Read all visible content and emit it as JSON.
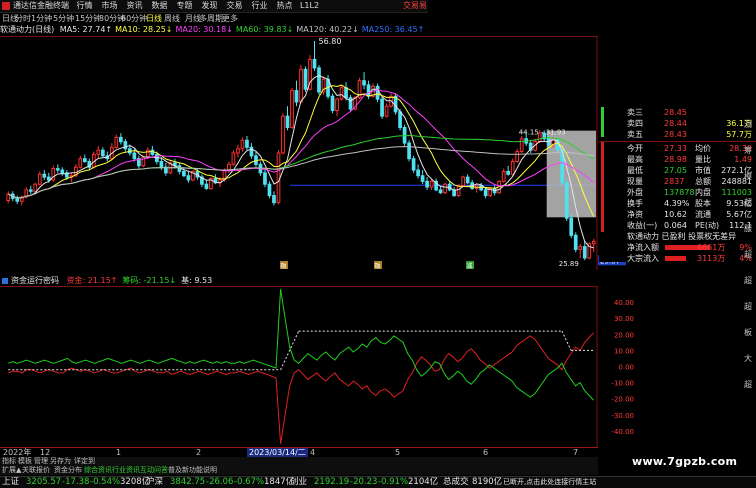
{
  "window": {
    "app_title": "通达信金融终端",
    "menu": [
      "行情",
      "市场",
      "资讯",
      "数据",
      "专题",
      "发现",
      "交易",
      "行业",
      "热点",
      "L1L2"
    ],
    "trade_button": "交易易"
  },
  "periods": {
    "items": [
      "日线",
      "分时",
      "1分钟",
      "5分钟",
      "15分钟",
      "30分钟",
      "60分钟",
      "日线",
      "周线",
      "月线",
      "多周期",
      "更多"
    ],
    "active_index": 7
  },
  "ma_legend": {
    "stock": "软通动力(日线)",
    "items": [
      {
        "label": "MA5: 27.74↑",
        "color": "#e6e6e6"
      },
      {
        "label": "MA10: 28.25↓",
        "color": "#ffff40"
      },
      {
        "label": "MA20: 30.18↓",
        "color": "#ff40ff"
      },
      {
        "label": "MA60: 39.83↓",
        "color": "#30d030"
      },
      {
        "label": "MA120: 40.22↓",
        "color": "#c0c0c0"
      },
      {
        "label": "MA250: 36.45↑",
        "color": "#3070ff"
      }
    ]
  },
  "price_axis": {
    "labels": [
      "46.00",
      "44.00",
      "42.00",
      "40.00",
      "38.00",
      "36.00",
      "34.00",
      "32.00",
      "30.00",
      "28.00",
      "26.00"
    ],
    "last_price_tag": "25.87"
  },
  "annotations": {
    "high_label": "56.80",
    "range_label": "44.15 - 31.93",
    "low_label": "25.89",
    "event_markers": [
      "融",
      "融",
      "减"
    ]
  },
  "order_book": {
    "rows": [
      {
        "label": "卖三",
        "price": "28.45",
        "vol": ""
      },
      {
        "label": "卖四",
        "price": "28.44",
        "vol": "36.1万"
      },
      {
        "label": "卖五",
        "price": "28.43",
        "vol": "57.7万"
      }
    ]
  },
  "quote_panel": {
    "rows": [
      {
        "l1": "今开",
        "v1": "27.33",
        "l2": "均价",
        "v2": "28.39"
      },
      {
        "l1": "最高",
        "v1": "28.98",
        "l2": "量比",
        "v2": "1.49"
      },
      {
        "l1": "最低",
        "v1": "27.05",
        "l2": "市值",
        "v2": "272.1亿"
      },
      {
        "l1": "现量",
        "v1": "2837",
        "l2": "总额",
        "v2": "248881"
      },
      {
        "l1": "外盘",
        "v1": "137878",
        "l2": "内盘",
        "v2": "111003"
      },
      {
        "l1": "换手",
        "v1": "4.39%",
        "l2": "股本",
        "v2": "9.53亿"
      },
      {
        "l1": "净资",
        "v1": "10.62",
        "l2": "流通",
        "v2": "5.67亿"
      },
      {
        "l1": "收益(一)",
        "v1": "0.064",
        "l2": "PE(动)",
        "v2": "112.1"
      }
    ],
    "tags": "软通动力 已盈利 投票权无差异",
    "flows": [
      {
        "label": "净流入额",
        "value": "6661万",
        "pct": "9%",
        "ratio": 0.62
      },
      {
        "label": "大宗流入",
        "value": "3113万",
        "pct": "4%",
        "ratio": 0.29
      }
    ]
  },
  "sub_indicator": {
    "name": "资金运行密码",
    "items": [
      {
        "label": "资金: 21.15↑",
        "color": "#ff3a3a"
      },
      {
        "label": "筹码: -21.15↓",
        "color": "#30d030"
      },
      {
        "label": "基: 9.53",
        "color": "#e6e6e6"
      }
    ],
    "axis_labels": [
      "40.00",
      "30.00",
      "20.00",
      "10.00",
      "0.00",
      "-10.00",
      "-20.00",
      "-30.00",
      "-40.00"
    ]
  },
  "x_axis": {
    "labels": [
      "2022年",
      "12",
      "1",
      "2",
      "2023/03/14/二",
      "4",
      "5",
      "6",
      "7"
    ],
    "selected_index": 4
  },
  "tabs_row1": {
    "items": [
      "指标",
      "模板",
      "管理",
      "另存为",
      "详定到"
    ],
    "colors": [
      "#c0c0c0",
      "#c0c0c0",
      "#c0c0c0",
      "#c0c0c0",
      "#c0c0c0"
    ]
  },
  "tabs_row2": {
    "items": [
      "扩展▲",
      "关联报价",
      "资金分布",
      "综合资讯",
      "行业资讯",
      "互动问答",
      "普及新功能说明"
    ],
    "colors": [
      "#c0c0c0",
      "#c0c0c0",
      "#c0c0c0",
      "#30d030",
      "#30d030",
      "#30d030",
      "#c0c0c0"
    ]
  },
  "status": {
    "indices": [
      {
        "name": "上证",
        "value": "3205.57",
        "change": "-17.38",
        "pct": "-0.54%",
        "amount": "3208亿"
      },
      {
        "name": "沪深",
        "value": "3842.75",
        "change": "-26.06",
        "pct": "-0.67%",
        "amount": "1847亿"
      },
      {
        "name": "创业",
        "value": "2192.19",
        "change": "-20.23",
        "pct": "-0.91%",
        "amount": "2104亿"
      }
    ],
    "total_label": "总成交",
    "total_value": "8190亿",
    "message": "已断开,点击此处连接行情主站"
  },
  "watermark": "www.7gpzb.com",
  "sidebar": [
    "测",
    "筹",
    "模",
    "超",
    "服",
    "超",
    "超",
    "超",
    "板",
    "大",
    "超"
  ],
  "chart_data": {
    "type": "candlestick",
    "title": "软通动力(日线)",
    "ylim": [
      24.5,
      57.5
    ],
    "ohlc": [
      [
        34.3,
        35.6,
        33.9,
        35.2
      ],
      [
        35.2,
        35.6,
        34.2,
        34.6
      ],
      [
        34.6,
        35.0,
        33.8,
        34.2
      ],
      [
        34.2,
        35.0,
        33.6,
        34.8
      ],
      [
        34.8,
        36.2,
        34.6,
        35.8
      ],
      [
        35.8,
        36.4,
        35.2,
        35.6
      ],
      [
        35.6,
        36.8,
        35.4,
        36.6
      ],
      [
        36.6,
        38.4,
        36.4,
        38.0
      ],
      [
        38.0,
        38.6,
        37.2,
        37.6
      ],
      [
        37.6,
        38.2,
        36.8,
        37.2
      ],
      [
        37.2,
        39.2,
        37.0,
        38.8
      ],
      [
        38.8,
        39.4,
        38.2,
        38.6
      ],
      [
        38.6,
        39.0,
        37.8,
        38.2
      ],
      [
        38.2,
        38.6,
        37.2,
        37.6
      ],
      [
        37.6,
        38.2,
        36.9,
        37.8
      ],
      [
        37.8,
        39.4,
        37.6,
        39.0
      ],
      [
        39.0,
        40.6,
        38.8,
        40.2
      ],
      [
        40.2,
        40.8,
        39.6,
        39.8
      ],
      [
        39.8,
        40.2,
        38.6,
        39.0
      ],
      [
        39.0,
        41.2,
        38.8,
        40.8
      ],
      [
        40.8,
        42.0,
        40.2,
        41.4
      ],
      [
        41.4,
        41.8,
        40.4,
        40.6
      ],
      [
        40.6,
        41.2,
        39.8,
        40.2
      ],
      [
        40.2,
        42.4,
        40.0,
        41.8
      ],
      [
        41.8,
        43.6,
        41.6,
        43.2
      ],
      [
        43.2,
        43.8,
        42.2,
        42.6
      ],
      [
        42.6,
        43.0,
        41.2,
        41.6
      ],
      [
        41.6,
        42.2,
        40.6,
        41.0
      ],
      [
        41.0,
        41.6,
        39.8,
        40.2
      ],
      [
        40.2,
        40.6,
        38.8,
        39.2
      ],
      [
        39.2,
        40.6,
        39.0,
        40.4
      ],
      [
        40.4,
        41.8,
        40.2,
        41.4
      ],
      [
        41.4,
        42.0,
        40.6,
        40.8
      ],
      [
        40.8,
        41.2,
        39.4,
        39.8
      ],
      [
        39.8,
        40.4,
        38.6,
        39.0
      ],
      [
        39.0,
        39.6,
        37.8,
        38.2
      ],
      [
        38.2,
        39.8,
        38.0,
        39.6
      ],
      [
        39.6,
        40.2,
        38.8,
        39.2
      ],
      [
        39.2,
        39.6,
        38.0,
        38.4
      ],
      [
        38.4,
        39.0,
        37.6,
        37.8
      ],
      [
        37.8,
        38.4,
        36.8,
        37.2
      ],
      [
        37.2,
        38.6,
        37.0,
        38.4
      ],
      [
        38.4,
        38.8,
        37.2,
        37.6
      ],
      [
        37.6,
        38.0,
        36.2,
        36.6
      ],
      [
        36.6,
        37.2,
        35.8,
        36.0
      ],
      [
        36.0,
        37.6,
        35.8,
        37.4
      ],
      [
        37.4,
        38.0,
        36.6,
        36.8
      ],
      [
        36.8,
        37.6,
        36.2,
        37.2
      ],
      [
        37.2,
        38.8,
        37.0,
        38.6
      ],
      [
        38.6,
        39.8,
        38.2,
        39.4
      ],
      [
        39.4,
        41.4,
        39.2,
        41.0
      ],
      [
        41.0,
        42.2,
        40.4,
        41.6
      ],
      [
        41.6,
        43.2,
        41.2,
        42.8
      ],
      [
        42.8,
        43.4,
        41.4,
        41.8
      ],
      [
        41.8,
        42.4,
        40.2,
        40.6
      ],
      [
        40.6,
        41.2,
        39.0,
        39.4
      ],
      [
        39.4,
        39.8,
        37.8,
        38.2
      ],
      [
        38.2,
        38.6,
        36.2,
        36.6
      ],
      [
        36.6,
        37.0,
        34.6,
        35.0
      ],
      [
        35.0,
        35.6,
        33.6,
        34.0
      ],
      [
        34.0,
        41.4,
        33.8,
        41.0
      ],
      [
        41.0,
        46.6,
        40.8,
        46.2
      ],
      [
        46.2,
        47.6,
        44.2,
        44.6
      ],
      [
        44.6,
        50.2,
        44.4,
        49.8
      ],
      [
        49.8,
        51.2,
        47.6,
        48.2
      ],
      [
        48.2,
        53.4,
        48.0,
        52.8
      ],
      [
        52.8,
        53.2,
        49.6,
        50.0
      ],
      [
        50.0,
        54.8,
        49.8,
        54.2
      ],
      [
        54.2,
        56.8,
        52.6,
        53.0
      ],
      [
        53.0,
        53.4,
        49.2,
        49.6
      ],
      [
        49.6,
        51.8,
        49.2,
        51.4
      ],
      [
        51.4,
        52.0,
        48.6,
        49.0
      ],
      [
        49.0,
        49.4,
        46.6,
        47.0
      ],
      [
        47.0,
        48.8,
        46.2,
        48.6
      ],
      [
        48.6,
        50.6,
        48.4,
        50.2
      ],
      [
        50.2,
        51.0,
        48.4,
        48.8
      ],
      [
        48.8,
        49.2,
        46.8,
        47.2
      ],
      [
        47.2,
        49.0,
        47.0,
        48.8
      ],
      [
        48.8,
        51.6,
        48.6,
        51.2
      ],
      [
        51.2,
        52.4,
        50.0,
        50.6
      ],
      [
        50.6,
        51.2,
        48.6,
        49.0
      ],
      [
        49.0,
        50.8,
        48.8,
        50.4
      ],
      [
        50.4,
        50.8,
        48.2,
        48.6
      ],
      [
        48.6,
        49.0,
        45.8,
        46.2
      ],
      [
        46.2,
        48.0,
        46.0,
        47.6
      ],
      [
        47.6,
        49.4,
        47.4,
        49.0
      ],
      [
        49.0,
        49.4,
        46.4,
        46.8
      ],
      [
        46.8,
        47.2,
        44.2,
        44.6
      ],
      [
        44.6,
        45.0,
        42.0,
        42.4
      ],
      [
        42.4,
        42.8,
        39.8,
        40.2
      ],
      [
        40.2,
        40.6,
        38.2,
        38.6
      ],
      [
        38.6,
        39.4,
        37.4,
        37.8
      ],
      [
        37.8,
        38.6,
        36.6,
        37.0
      ],
      [
        37.0,
        37.6,
        35.8,
        36.2
      ],
      [
        36.2,
        37.4,
        35.8,
        37.0
      ],
      [
        37.0,
        37.4,
        35.6,
        35.8
      ],
      [
        35.8,
        36.4,
        35.2,
        35.4
      ],
      [
        35.4,
        36.8,
        35.2,
        36.6
      ],
      [
        36.6,
        37.0,
        35.6,
        35.8
      ],
      [
        35.8,
        36.2,
        34.8,
        35.0
      ],
      [
        35.0,
        36.6,
        34.8,
        36.4
      ],
      [
        36.4,
        37.8,
        36.2,
        37.6
      ],
      [
        37.6,
        38.0,
        36.6,
        36.8
      ],
      [
        36.8,
        37.2,
        35.8,
        36.0
      ],
      [
        36.0,
        36.6,
        35.4,
        36.4
      ],
      [
        36.4,
        36.8,
        35.6,
        35.8
      ],
      [
        35.8,
        36.2,
        34.6,
        35.0
      ],
      [
        35.0,
        36.2,
        34.8,
        36.0
      ],
      [
        36.0,
        36.4,
        35.0,
        35.4
      ],
      [
        35.4,
        37.2,
        35.2,
        37.0
      ],
      [
        37.0,
        38.8,
        36.8,
        38.4
      ],
      [
        38.4,
        39.2,
        37.8,
        38.0
      ],
      [
        38.0,
        40.2,
        37.8,
        39.8
      ],
      [
        39.8,
        41.6,
        39.6,
        41.2
      ],
      [
        41.2,
        43.4,
        41.0,
        43.0
      ],
      [
        43.0,
        44.0,
        42.0,
        42.4
      ],
      [
        42.4,
        42.8,
        41.0,
        41.4
      ],
      [
        41.4,
        43.0,
        41.2,
        42.6
      ],
      [
        42.6,
        44.2,
        42.4,
        43.8
      ],
      [
        43.8,
        44.2,
        42.6,
        43.0
      ],
      [
        43.0,
        43.4,
        42.0,
        42.2
      ],
      [
        42.2,
        43.2,
        41.8,
        42.8
      ],
      [
        42.8,
        43.2,
        41.0,
        41.4
      ],
      [
        41.4,
        41.8,
        36.4,
        36.8
      ],
      [
        36.8,
        37.2,
        31.4,
        31.8
      ],
      [
        31.8,
        32.4,
        29.0,
        29.4
      ],
      [
        29.4,
        29.8,
        27.0,
        27.4
      ],
      [
        27.4,
        28.2,
        26.2,
        27.8
      ],
      [
        27.8,
        28.6,
        25.89,
        26.2
      ],
      [
        26.2,
        28.4,
        26.0,
        28.2
      ],
      [
        28.2,
        28.9,
        27.05,
        28.5
      ]
    ],
    "ma250_level": 36.45,
    "sub_series": {
      "ylim": [
        -50,
        50
      ],
      "red": [
        -4,
        -3,
        -3,
        -4,
        -2,
        -2,
        -3,
        -4,
        -3,
        -2,
        -3,
        -4,
        -4,
        -2,
        -1,
        -2,
        -3,
        -2,
        -3,
        -4,
        -3,
        -2,
        -3,
        -4,
        -4,
        -3,
        -2,
        -1,
        -3,
        -4,
        -3,
        -2,
        -3,
        -4,
        -4,
        -3,
        -5,
        -4,
        -3,
        -4,
        -5,
        -4,
        -3,
        -4,
        -5,
        -4,
        -3,
        -4,
        -5,
        -4,
        -4,
        -3,
        -4,
        -5,
        -4,
        -3,
        -4,
        -5,
        -6,
        -7,
        -48,
        -30,
        -12,
        -4,
        -2,
        -5,
        -8,
        -6,
        -4,
        -7,
        -9,
        -6,
        -4,
        -8,
        -10,
        -12,
        -9,
        -11,
        -14,
        -12,
        -16,
        -18,
        -15,
        -14,
        -16,
        -19,
        -17,
        -15,
        -8,
        -4,
        2,
        6,
        4,
        1,
        -3,
        -2,
        4,
        8,
        6,
        3,
        5,
        9,
        11,
        8,
        4,
        2,
        -1,
        1,
        3,
        5,
        7,
        9,
        13,
        15,
        17,
        19,
        17,
        13,
        9,
        5,
        3,
        1,
        -2,
        4,
        8,
        12,
        10,
        15,
        18,
        21
      ],
      "green": [
        2,
        3,
        2,
        3,
        4,
        3,
        2,
        3,
        4,
        3,
        2,
        3,
        4,
        5,
        3,
        2,
        3,
        4,
        3,
        2,
        3,
        4,
        5,
        4,
        3,
        2,
        3,
        4,
        3,
        2,
        3,
        4,
        3,
        2,
        3,
        4,
        5,
        4,
        3,
        2,
        3,
        2,
        3,
        4,
        3,
        2,
        3,
        2,
        3,
        2,
        2,
        3,
        2,
        3,
        4,
        3,
        2,
        1,
        0,
        -1,
        48,
        30,
        12,
        4,
        2,
        5,
        8,
        6,
        4,
        7,
        9,
        6,
        4,
        8,
        10,
        12,
        9,
        11,
        14,
        12,
        16,
        18,
        15,
        14,
        16,
        19,
        17,
        15,
        8,
        4,
        -2,
        -6,
        -4,
        -1,
        3,
        2,
        -4,
        -8,
        -6,
        -3,
        -5,
        -9,
        -11,
        -8,
        -4,
        -2,
        1,
        -1,
        -3,
        -5,
        -7,
        -9,
        -13,
        -15,
        -17,
        -19,
        -17,
        -13,
        -9,
        -5,
        -3,
        -1,
        2,
        -4,
        -8,
        -12,
        -10,
        -15,
        -18,
        -21
      ],
      "dotted_level_before": -2,
      "dotted_level_after": 22,
      "switch_index": 60
    }
  }
}
